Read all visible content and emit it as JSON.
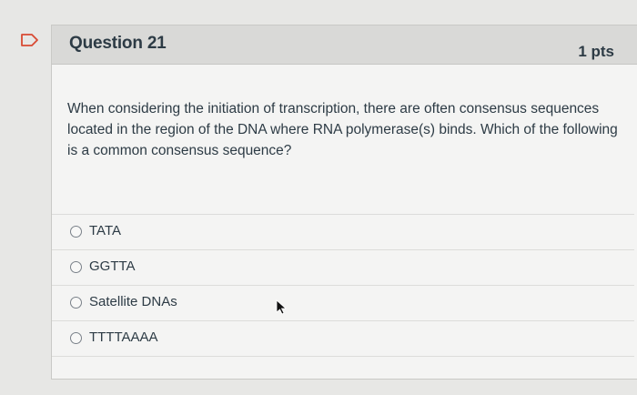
{
  "question": {
    "title": "Question 21",
    "points": "1 pts",
    "text": "When considering the initiation of transcription, there are often consensus sequences located in the region of the DNA where RNA polymerase(s) binds. Which of the following is a common consensus sequence?"
  },
  "answers": [
    {
      "label": "TATA",
      "selected": false
    },
    {
      "label": "GGTTA",
      "selected": false
    },
    {
      "label": "Satellite DNAs",
      "selected": false
    },
    {
      "label": "TTTTAAAA",
      "selected": false
    }
  ],
  "icons": {
    "bookmark": "bookmark-flag-icon",
    "cursor": "mouse-cursor-icon"
  },
  "colors": {
    "text": "#2d3b45",
    "header_bg": "#d9d9d7",
    "accent": "#e0402a"
  }
}
